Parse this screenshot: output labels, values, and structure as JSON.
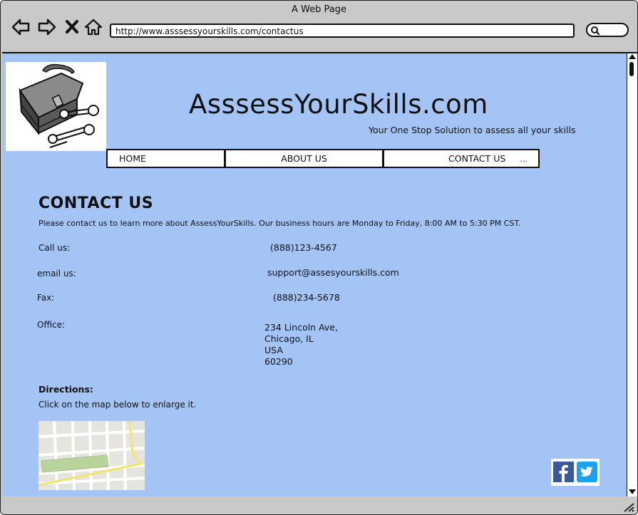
{
  "browser": {
    "window_title": "A Web Page",
    "url": "http://www.asssessyourskills.com/contactus",
    "icons": [
      "back-arrow-icon",
      "forward-arrow-icon",
      "close-x-icon",
      "home-icon",
      "search-icon"
    ]
  },
  "site": {
    "title": "AsssessYourSkills.com",
    "tagline": "Your One Stop Solution to assess all your skills",
    "logo_icon": "toolbox-with-wrenches-icon"
  },
  "menu": {
    "items": [
      {
        "label": "HOME"
      },
      {
        "label": "ABOUT US"
      },
      {
        "label": "CONTACT US",
        "suffix": "..."
      }
    ]
  },
  "contact": {
    "heading": "CONTACT US",
    "intro": "Please contact us to learn more about AssessYourSkills. Our business hours are Monday to Friday, 8:00 AM to 5:30 PM CST.",
    "call_label": "Call us:",
    "call_value": "(888)123-4567",
    "email_label": "email us:",
    "email_value": "support@assesyourskills.com",
    "fax_label": "Fax:",
    "fax_value": "(888)234-5678",
    "office_label": "Office:",
    "office_lines": [
      "234 Lincoln Ave,",
      "Chicago, IL",
      "USA",
      "60290"
    ]
  },
  "directions": {
    "heading": "Directions:",
    "text": "Click on the map below to enlarge it."
  },
  "social": {
    "icons": [
      "facebook-icon",
      "twitter-icon"
    ]
  },
  "colors": {
    "page_background": "#a3c4f5",
    "chrome": "#c9c9c9",
    "facebook": "#3b5998",
    "twitter": "#1da1f2"
  }
}
